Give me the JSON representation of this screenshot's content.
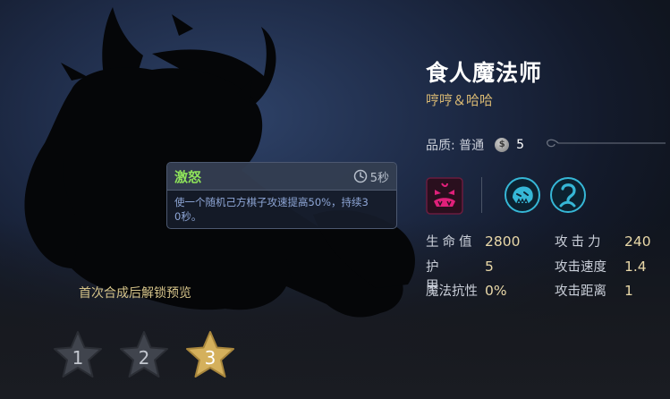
{
  "hero": {
    "name": "食人魔法师",
    "subtitle": "哼哼＆哈哈",
    "quality_label": "品质: 普通",
    "cost": "5"
  },
  "skill": {
    "name": "激怒",
    "cooldown": "5秒",
    "desc_line1": "使一个随机己方棋子攻速提高50%，持续3",
    "desc_line2": "0秒。"
  },
  "unlock_hint": "首次合成后解锁预览",
  "stars": [
    {
      "label": "1",
      "active": false
    },
    {
      "label": "2",
      "active": false
    },
    {
      "label": "3",
      "active": true
    }
  ],
  "traits": {
    "race_icon": "ogre-face-icon",
    "class_icons": [
      "beast-paw-icon",
      "mage-swirl-icon"
    ]
  },
  "stats": {
    "hp_label": "生命值",
    "hp": "2800",
    "atk_label": "攻击力",
    "atk": "240",
    "armor_label": "护甲",
    "armor": "5",
    "atk_speed_label": "攻击速度",
    "atk_speed": "1.4",
    "magic_res_label": "魔法抗性",
    "magic_res": "0%",
    "range_label": "攻击距离",
    "range": "1"
  },
  "colors": {
    "accent_gold": "#d9b973",
    "skill_green": "#8ee35a",
    "star_active": "#d4b05c",
    "class_cyan": "#36b7d6",
    "race_pink": "#e0207a"
  }
}
